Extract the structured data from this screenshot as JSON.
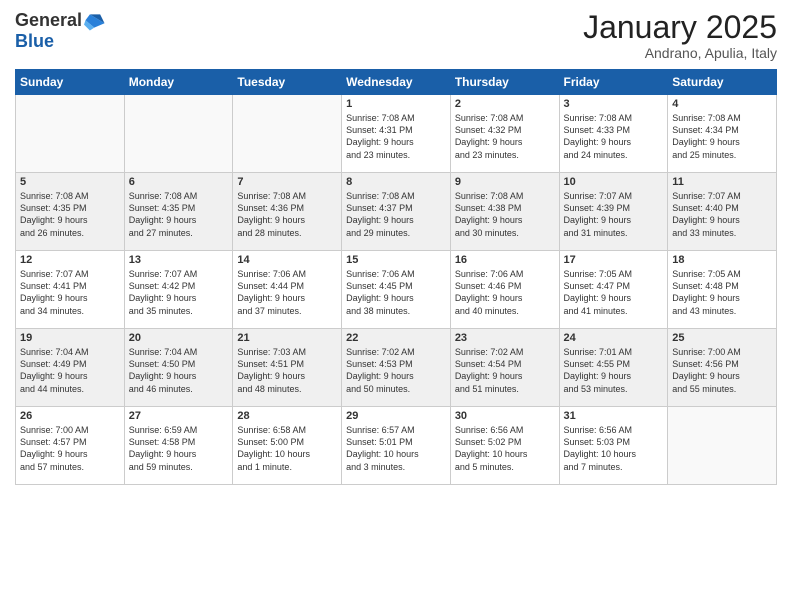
{
  "logo": {
    "general": "General",
    "blue": "Blue"
  },
  "header": {
    "month": "January 2025",
    "location": "Andrano, Apulia, Italy"
  },
  "weekdays": [
    "Sunday",
    "Monday",
    "Tuesday",
    "Wednesday",
    "Thursday",
    "Friday",
    "Saturday"
  ],
  "weeks": [
    [
      {
        "day": "",
        "info": ""
      },
      {
        "day": "",
        "info": ""
      },
      {
        "day": "",
        "info": ""
      },
      {
        "day": "1",
        "info": "Sunrise: 7:08 AM\nSunset: 4:31 PM\nDaylight: 9 hours\nand 23 minutes."
      },
      {
        "day": "2",
        "info": "Sunrise: 7:08 AM\nSunset: 4:32 PM\nDaylight: 9 hours\nand 23 minutes."
      },
      {
        "day": "3",
        "info": "Sunrise: 7:08 AM\nSunset: 4:33 PM\nDaylight: 9 hours\nand 24 minutes."
      },
      {
        "day": "4",
        "info": "Sunrise: 7:08 AM\nSunset: 4:34 PM\nDaylight: 9 hours\nand 25 minutes."
      }
    ],
    [
      {
        "day": "5",
        "info": "Sunrise: 7:08 AM\nSunset: 4:35 PM\nDaylight: 9 hours\nand 26 minutes."
      },
      {
        "day": "6",
        "info": "Sunrise: 7:08 AM\nSunset: 4:35 PM\nDaylight: 9 hours\nand 27 minutes."
      },
      {
        "day": "7",
        "info": "Sunrise: 7:08 AM\nSunset: 4:36 PM\nDaylight: 9 hours\nand 28 minutes."
      },
      {
        "day": "8",
        "info": "Sunrise: 7:08 AM\nSunset: 4:37 PM\nDaylight: 9 hours\nand 29 minutes."
      },
      {
        "day": "9",
        "info": "Sunrise: 7:08 AM\nSunset: 4:38 PM\nDaylight: 9 hours\nand 30 minutes."
      },
      {
        "day": "10",
        "info": "Sunrise: 7:07 AM\nSunset: 4:39 PM\nDaylight: 9 hours\nand 31 minutes."
      },
      {
        "day": "11",
        "info": "Sunrise: 7:07 AM\nSunset: 4:40 PM\nDaylight: 9 hours\nand 33 minutes."
      }
    ],
    [
      {
        "day": "12",
        "info": "Sunrise: 7:07 AM\nSunset: 4:41 PM\nDaylight: 9 hours\nand 34 minutes."
      },
      {
        "day": "13",
        "info": "Sunrise: 7:07 AM\nSunset: 4:42 PM\nDaylight: 9 hours\nand 35 minutes."
      },
      {
        "day": "14",
        "info": "Sunrise: 7:06 AM\nSunset: 4:44 PM\nDaylight: 9 hours\nand 37 minutes."
      },
      {
        "day": "15",
        "info": "Sunrise: 7:06 AM\nSunset: 4:45 PM\nDaylight: 9 hours\nand 38 minutes."
      },
      {
        "day": "16",
        "info": "Sunrise: 7:06 AM\nSunset: 4:46 PM\nDaylight: 9 hours\nand 40 minutes."
      },
      {
        "day": "17",
        "info": "Sunrise: 7:05 AM\nSunset: 4:47 PM\nDaylight: 9 hours\nand 41 minutes."
      },
      {
        "day": "18",
        "info": "Sunrise: 7:05 AM\nSunset: 4:48 PM\nDaylight: 9 hours\nand 43 minutes."
      }
    ],
    [
      {
        "day": "19",
        "info": "Sunrise: 7:04 AM\nSunset: 4:49 PM\nDaylight: 9 hours\nand 44 minutes."
      },
      {
        "day": "20",
        "info": "Sunrise: 7:04 AM\nSunset: 4:50 PM\nDaylight: 9 hours\nand 46 minutes."
      },
      {
        "day": "21",
        "info": "Sunrise: 7:03 AM\nSunset: 4:51 PM\nDaylight: 9 hours\nand 48 minutes."
      },
      {
        "day": "22",
        "info": "Sunrise: 7:02 AM\nSunset: 4:53 PM\nDaylight: 9 hours\nand 50 minutes."
      },
      {
        "day": "23",
        "info": "Sunrise: 7:02 AM\nSunset: 4:54 PM\nDaylight: 9 hours\nand 51 minutes."
      },
      {
        "day": "24",
        "info": "Sunrise: 7:01 AM\nSunset: 4:55 PM\nDaylight: 9 hours\nand 53 minutes."
      },
      {
        "day": "25",
        "info": "Sunrise: 7:00 AM\nSunset: 4:56 PM\nDaylight: 9 hours\nand 55 minutes."
      }
    ],
    [
      {
        "day": "26",
        "info": "Sunrise: 7:00 AM\nSunset: 4:57 PM\nDaylight: 9 hours\nand 57 minutes."
      },
      {
        "day": "27",
        "info": "Sunrise: 6:59 AM\nSunset: 4:58 PM\nDaylight: 9 hours\nand 59 minutes."
      },
      {
        "day": "28",
        "info": "Sunrise: 6:58 AM\nSunset: 5:00 PM\nDaylight: 10 hours\nand 1 minute."
      },
      {
        "day": "29",
        "info": "Sunrise: 6:57 AM\nSunset: 5:01 PM\nDaylight: 10 hours\nand 3 minutes."
      },
      {
        "day": "30",
        "info": "Sunrise: 6:56 AM\nSunset: 5:02 PM\nDaylight: 10 hours\nand 5 minutes."
      },
      {
        "day": "31",
        "info": "Sunrise: 6:56 AM\nSunset: 5:03 PM\nDaylight: 10 hours\nand 7 minutes."
      },
      {
        "day": "",
        "info": ""
      }
    ]
  ]
}
